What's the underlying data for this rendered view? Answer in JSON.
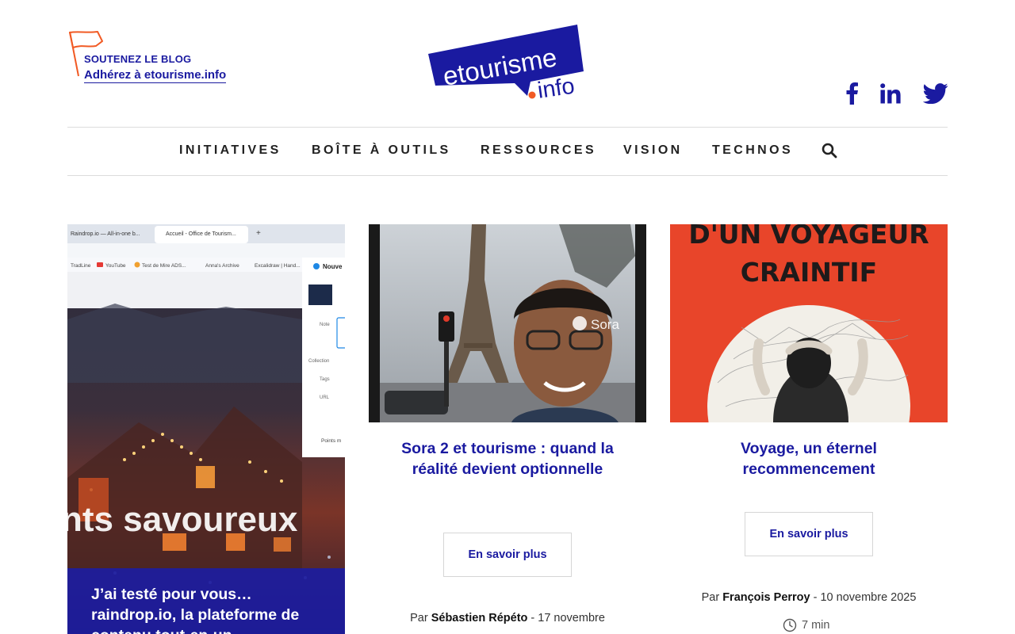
{
  "header": {
    "support_title": "SOUTENEZ LE BLOG",
    "support_link": "Adhérez à etourisme.info",
    "logo_line1": "etourisme",
    "logo_line2": ".info",
    "brand_blue": "#1a1aa0",
    "accent_orange": "#f15a24",
    "social": [
      "facebook-icon",
      "linkedin-icon",
      "twitter-icon"
    ]
  },
  "nav": {
    "items": [
      "INITIATIVES",
      "BOÎTE À OUTILS",
      "RESSOURCES",
      "VISION",
      "TECHNOS"
    ],
    "search_icon": "search-icon"
  },
  "cards": [
    {
      "image_text": "nts savoureux",
      "browser_tabs": [
        "Raindrop.io — All-in-one b...",
        "Accueil - Office de Tourism..."
      ],
      "bookmarks": [
        "TradLine",
        "YouTube",
        "Test de Mire ADS...",
        "Anna's Archive",
        "Excalidraw | Hand..."
      ],
      "panel_title": "Nouve",
      "panel_labels": [
        "Note",
        "Collection",
        "Tags",
        "URL",
        "Points m"
      ],
      "title": "J’ai testé pour vous… raindrop.io, la plateforme de contenu tout-en-un"
    },
    {
      "image_badge": "Sora",
      "title": "Sora 2 et tourisme : quand la réalité devient optionnelle",
      "button": "En savoir plus",
      "by": "Par",
      "author": "Sébastien Répéto",
      "date": "- 17 novembre"
    },
    {
      "image_line1": "D'UN VOYAGEUR",
      "image_line2": "CRAINTIF",
      "title": "Voyage, un éternel recommencement",
      "button": "En savoir plus",
      "by": "Par",
      "author": "François Perroy",
      "date": "- 10 novembre 2025",
      "read_time": "7 min"
    }
  ]
}
